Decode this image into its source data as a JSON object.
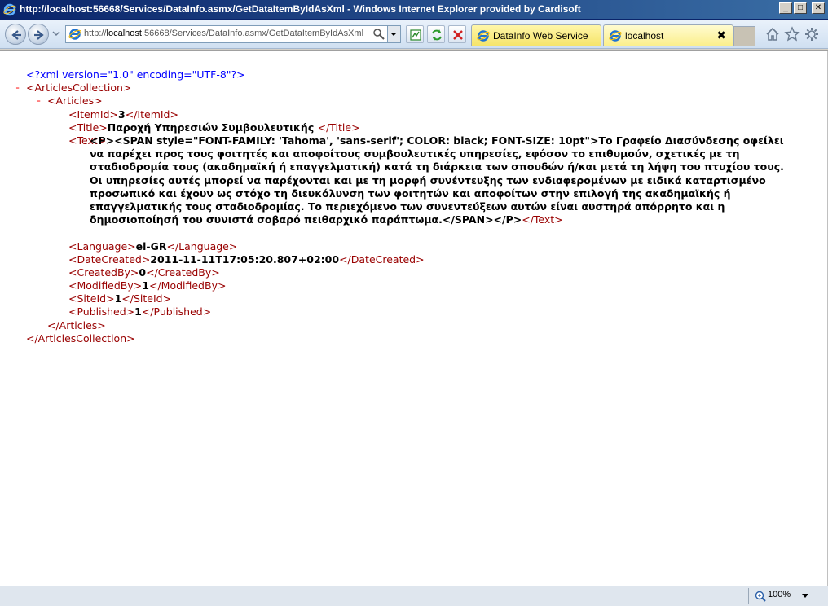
{
  "window": {
    "title": "http://localhost:56668/Services/DataInfo.asmx/GetDataItemByIdAsXml - Windows Internet Explorer provided by Cardisoft",
    "minimize": "_",
    "maximize": "□",
    "close": "✕"
  },
  "address": {
    "prefix": "http://",
    "host": "localhost",
    "rest": ":56668/Services/DataInfo.asmx/GetDataItemByIdAsXml"
  },
  "tabs": [
    {
      "label": "DataInfo Web Service"
    },
    {
      "label": "localhost",
      "close": "✖"
    }
  ],
  "xml": {
    "declaration": "<?xml version=\"1.0\" encoding=\"UTF-8\"?>",
    "collapse_glyph": "-",
    "root_open": "<ArticlesCollection>",
    "root_close": "</ArticlesCollection>",
    "article_open": "<Articles>",
    "article_close": "</Articles>",
    "fields": {
      "item_id": {
        "open": "<ItemId>",
        "value": "3",
        "close": "</ItemId>"
      },
      "title": {
        "open": "<Title>",
        "value": "Παροχή Υπηρεσιών Συμβουλευτικής ",
        "close": "</Title>"
      },
      "text": {
        "open": "<Text>",
        "value": "<P><SPAN style=\"FONT-FAMILY: 'Tahoma', 'sans-serif'; COLOR: black; FONT-SIZE: 10pt\">Το Γραφείο Διασύνδεσης οφείλει να παρέχει προς τους φοιτητές και αποφοίτους συμβουλευτικές υπηρεσίες, εφόσον το επιθυμούν, σχετικές με τη σταδιοδρομία τους (ακαδημαϊκή ή επαγγελματική) κατά τη διάρκεια των σπουδών ή/και μετά τη λήψη του πτυχίου τους. Οι υπηρεσίες αυτές μπορεί να παρέχονται και με τη μορφή συνέντευξης των ενδιαφερομένων με ειδικά καταρτισμένο προσωπικό και έχουν ως στόχο τη διευκόλυνση των φοιτητών και αποφοίτων στην επιλογή της ακαδημαϊκής ή επαγγελματικής τους σταδιοδρομίας. Το περιεχόμενο των συνεντεύξεων αυτών είναι αυστηρά απόρρητο και η δημοσιοποίησή του συνιστά σοβαρό πειθαρχικό παράπτωμα.</SPAN></P>",
        "close": "</Text>"
      },
      "language": {
        "open": "<Language>",
        "value": "el-GR",
        "close": "</Language>"
      },
      "date_created": {
        "open": "<DateCreated>",
        "value": "2011-11-11T17:05:20.807+02:00",
        "close": "</DateCreated>"
      },
      "created_by": {
        "open": "<CreatedBy>",
        "value": "0",
        "close": "</CreatedBy>"
      },
      "modified_by": {
        "open": "<ModifiedBy>",
        "value": "1",
        "close": "</ModifiedBy>"
      },
      "site_id": {
        "open": "<SiteId>",
        "value": "1",
        "close": "</SiteId>"
      },
      "published": {
        "open": "<Published>",
        "value": "1",
        "close": "</Published>"
      }
    }
  },
  "status": {
    "zoom": "100%"
  },
  "icons": [
    "ie-icon",
    "back-arrow-icon",
    "forward-arrow-icon",
    "search-icon",
    "compatibility-icon",
    "refresh-icon",
    "stop-icon",
    "home-icon",
    "favorites-star-icon",
    "gear-icon",
    "zoom-icon"
  ],
  "colors": {
    "tag": "#990000",
    "bracket": "#0000ff",
    "collapse": "#ff0000"
  }
}
